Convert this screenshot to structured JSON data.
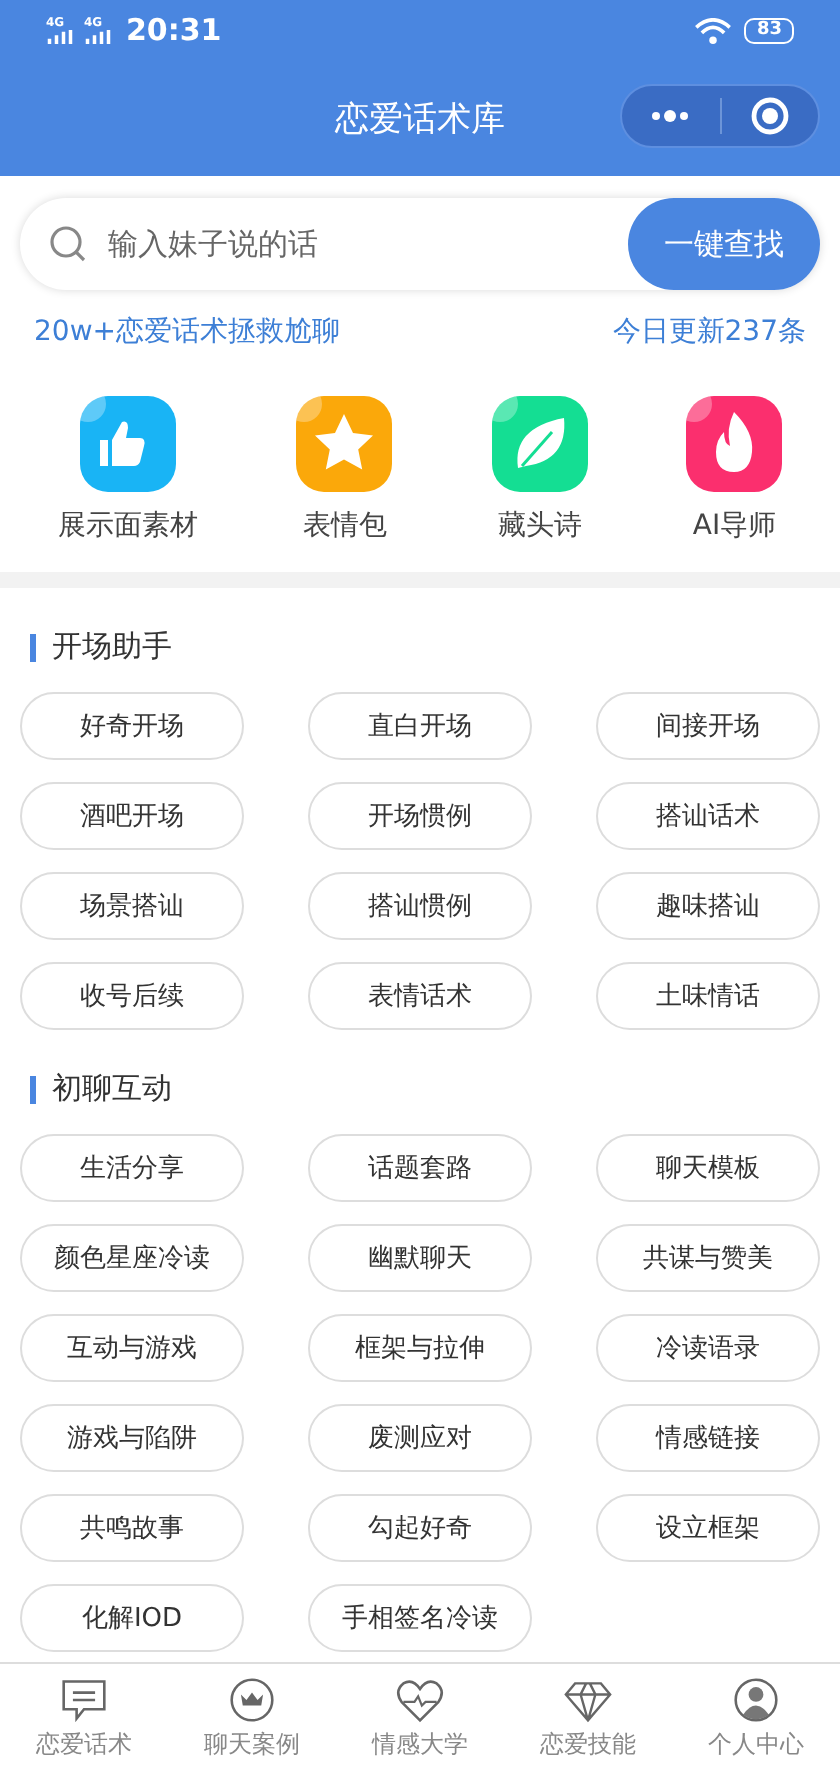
{
  "status_bar": {
    "signal_1": "4G",
    "signal_2": "4G",
    "time": "20:31",
    "battery": "83"
  },
  "header": {
    "title": "恋爱话术库"
  },
  "search": {
    "placeholder": "输入妹子说的话",
    "button": "一键查找"
  },
  "info": {
    "left": "20w+恋爱话术拯救尬聊",
    "right": "今日更新237条"
  },
  "shortcuts": [
    {
      "kind": "thumb",
      "label": "展示面素材",
      "color": "#19b4f5"
    },
    {
      "kind": "star",
      "label": "表情包",
      "color": "#fba80a"
    },
    {
      "kind": "leaf",
      "label": "藏头诗",
      "color": "#14de93"
    },
    {
      "kind": "fire",
      "label": "AI导师",
      "color": "#fb2f6e"
    }
  ],
  "sections": [
    {
      "title": "开场助手",
      "chips": [
        "好奇开场",
        "直白开场",
        "间接开场",
        "酒吧开场",
        "开场惯例",
        "搭讪话术",
        "场景搭讪",
        "搭讪惯例",
        "趣味搭讪",
        "收号后续",
        "表情话术",
        "土味情话"
      ]
    },
    {
      "title": "初聊互动",
      "chips": [
        "生活分享",
        "话题套路",
        "聊天模板",
        "颜色星座冷读",
        "幽默聊天",
        "共谋与赞美",
        "互动与游戏",
        "框架与拉伸",
        "冷读语录",
        "游戏与陷阱",
        "废测应对",
        "情感链接",
        "共鸣故事",
        "勾起好奇",
        "设立框架",
        "化解IOD",
        "手相签名冷读"
      ]
    }
  ],
  "tab_bar": [
    {
      "kind": "chat",
      "label": "恋爱话术",
      "selected": false
    },
    {
      "kind": "crown",
      "label": "聊天案例",
      "selected": false
    },
    {
      "kind": "heart",
      "label": "情感大学",
      "selected": false
    },
    {
      "kind": "diamond",
      "label": "恋爱技能",
      "selected": false
    },
    {
      "kind": "person",
      "label": "个人中心",
      "selected": false
    }
  ]
}
